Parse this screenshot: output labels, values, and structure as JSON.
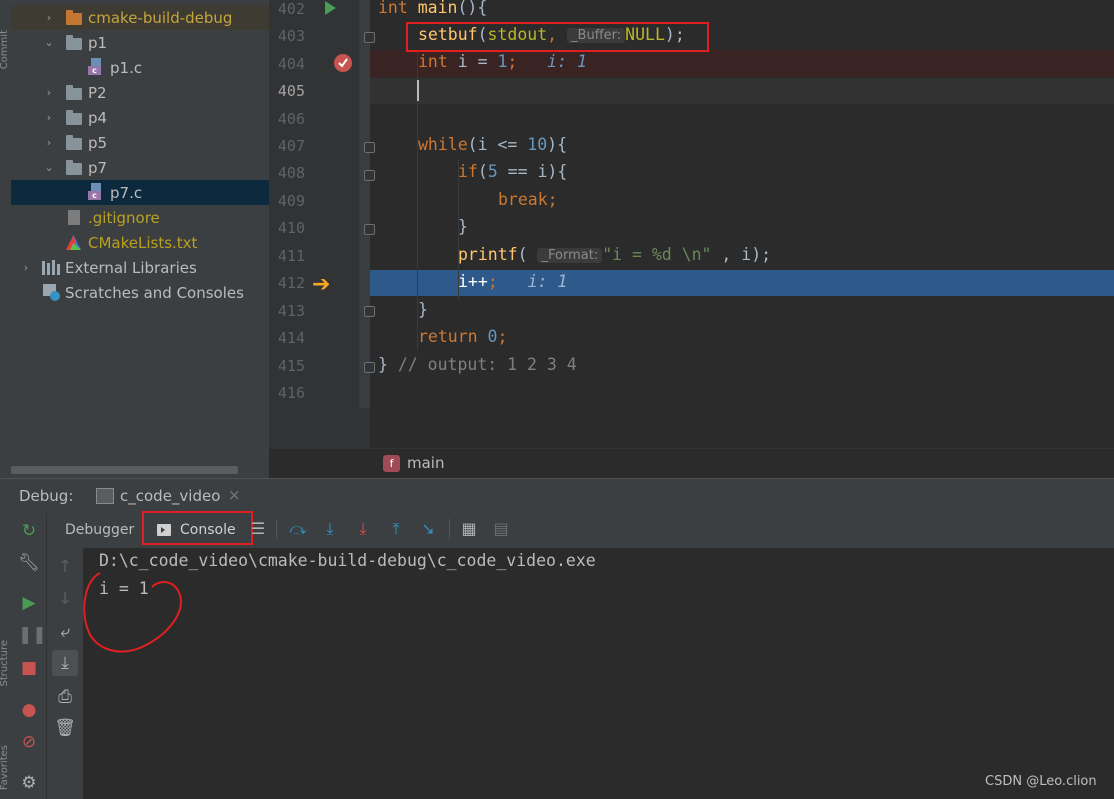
{
  "left_strip": {
    "commit_label": "Commit",
    "structure_label": "Structure",
    "favorites_label": "Favorites"
  },
  "project_tree": {
    "items": [
      {
        "label": "cmake-build-debug",
        "kind": "folder-orange",
        "expanded": false,
        "color": "#c5a53d"
      },
      {
        "label": "p1",
        "kind": "folder",
        "expanded": true
      },
      {
        "label": "p1.c",
        "kind": "c-file"
      },
      {
        "label": "P2",
        "kind": "folder",
        "expanded": false
      },
      {
        "label": "p4",
        "kind": "folder",
        "expanded": false
      },
      {
        "label": "p5",
        "kind": "folder",
        "expanded": false
      },
      {
        "label": "p7",
        "kind": "folder",
        "expanded": true
      },
      {
        "label": "p7.c",
        "kind": "c-file",
        "selected": true
      },
      {
        "label": ".gitignore",
        "kind": "gitignore",
        "color": "#b8a11f"
      },
      {
        "label": "CMakeLists.txt",
        "kind": "cmake",
        "color": "#b8a11f"
      },
      {
        "label": "External Libraries",
        "kind": "libraries",
        "expanded": false
      },
      {
        "label": "Scratches and Consoles",
        "kind": "scratches"
      }
    ]
  },
  "editor": {
    "line_numbers": [
      "402",
      "403",
      "404",
      "405",
      "406",
      "407",
      "408",
      "409",
      "410",
      "411",
      "412",
      "413",
      "414",
      "415",
      "416"
    ],
    "current_line": "405",
    "code": {
      "l402_kw": "int",
      "l402_fn": "main",
      "l402_rest": "(){",
      "l403_fn": "setbuf",
      "l403_a": "(",
      "l403_arg": "stdout",
      "l403_b": ", ",
      "l403_param": "_Buffer:",
      "l403_null": "NULL",
      "l403_end": ");",
      "l404_kw": "int",
      "l404_mid": " i = ",
      "l404_num": "1",
      "l404_end": ";",
      "l404_hint": "i: 1",
      "l407_kw": "while",
      "l407_a": "(i <= ",
      "l407_num": "10",
      "l407_end": "){",
      "l408_kw": "if",
      "l408_a": "(",
      "l408_num": "5",
      "l408_end": " == i){",
      "l409_kw": "break",
      "l409_end": ";",
      "l410": "}",
      "l411_fn": "printf",
      "l411_a": "( ",
      "l411_param": "_Format:",
      "l411_str": "\"i = %d \\n\"",
      "l411_end": " , i);",
      "l412_code": "i++",
      "l412_end": ";",
      "l412_hint": "i: 1",
      "l413": "}",
      "l414_kw": "return",
      "l414_sp": " ",
      "l414_num": "0",
      "l414_end": ";",
      "l415_brace": "}",
      "l415_cmt": " // output: 1 2 3 4"
    }
  },
  "breadcrumb": {
    "icon": "f",
    "label": "main"
  },
  "debug": {
    "title": "Debug:",
    "session_tab": "c_code_video",
    "close_glyph": "×",
    "tabs": {
      "debugger": "Debugger",
      "console": "Console"
    },
    "console_output": [
      "D:\\c_code_video\\cmake-build-debug\\c_code_video.exe",
      "i = 1"
    ]
  },
  "watermark": "CSDN @Leo.clion",
  "colors": {
    "keyword": "#cc7832",
    "function": "#ffc66d",
    "number": "#6897bb",
    "string": "#6a8759",
    "macro": "#bbb529",
    "execution_line": "#2d5a8a",
    "annotation_red": "#e02020"
  }
}
